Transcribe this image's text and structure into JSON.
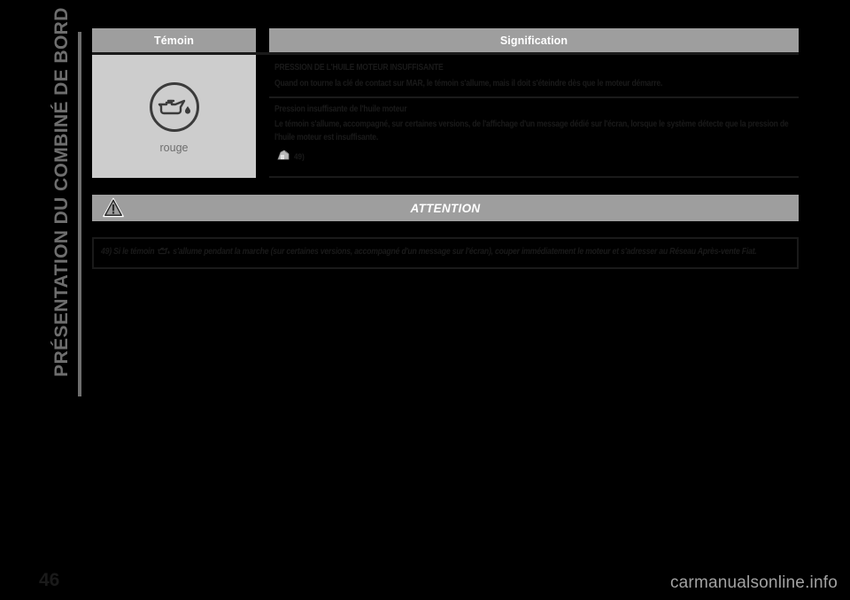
{
  "chapter": {
    "title": "PRÉSENTATION DU COMBINÉ DE BORD"
  },
  "table": {
    "headers": {
      "telltale": "Témoin",
      "meaning": "Signification"
    },
    "row": {
      "telltale": {
        "icon_name": "oil-can-icon",
        "color_label": "rouge"
      },
      "blocks": [
        {
          "title": "PRESSION DE L'HUILE MOTEUR INSUFFISANTE",
          "body": "Quand on tourne la clé de contact sur MAR, le témoin s'allume, mais il doit s'éteindre dès que le moteur démarre."
        },
        {
          "title": "Pression insuffisante de l'huile moteur",
          "body": "Le témoin s'allume, accompagné, sur certaines versions, de l'affichage d'un message dédié sur l'écran, lorsque le système détecte que la pression de l'huile moteur est insuffisante.",
          "reference_icon": "workshop-icon",
          "reference_mark": "49)"
        }
      ]
    }
  },
  "attention": {
    "icon_name": "warning-triangle-icon",
    "title": "ATTENTION",
    "note_mark": "49)",
    "note_text_before": "Si le témoin",
    "note_icon_name": "oil-can-inline-icon",
    "note_text_after": "s'allume pendant la marche (sur certaines versions, accompagné d'un message sur l'écran), couper immédiatement le moteur et s'adresser au Réseau Après-vente Fiat."
  },
  "footer": {
    "page_number": "46",
    "watermark": "carmanualsonline.info"
  },
  "colors": {
    "page_background": "#000000",
    "header_bar": "#9e9e9e",
    "telltale_cell": "#cdcdcd",
    "ink": "#1a1a1a",
    "muted": "#6e6e6e"
  }
}
